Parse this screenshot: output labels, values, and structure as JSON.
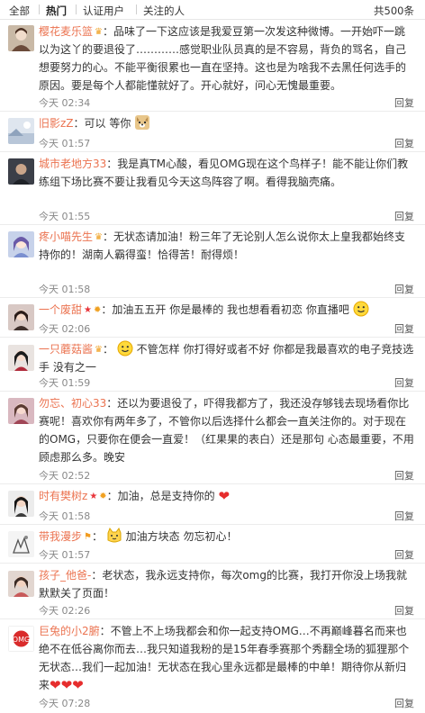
{
  "tabs": [
    "全部",
    "热门",
    "认证用户",
    "关注的人"
  ],
  "active_tab": "热门",
  "total_count": "共500条",
  "reply_label": "回复",
  "comments": [
    {
      "user": "樱花麦乐篮",
      "badge": "crown-badge-icon",
      "text": "：品味了一下这应该是我爱豆第一次发这种微博。一开始吓一跳以为这丫的要退役了…………感觉职业队员真的是不容易，背负的骂名，自己想要努力的心。不能平衡很累也一直在坚持。这也是为啥我不去黑任何选手的原因。要是每个人都能懂就好了。开心就好，问心无愧最重要。",
      "time": "今天 02:34"
    },
    {
      "user": "旧影zZ",
      "text": "：可以 等你",
      "time": "今天 01:57"
    },
    {
      "user": "城市老地方33",
      "text": "：我是真TM心酸，看见OMG现在这个鸟样子！能不能让你们教练组下场比赛不要让我看见今天这鸟阵容了啊。看得我脑壳痛。",
      "time": "今天 01:55"
    },
    {
      "user": "疼小喵先生",
      "badge": "crown-badge-icon",
      "text": "：无状态请加油！粉三年了无论别人怎么说你太上皇我都始终支持你的！湖南人霸得蛮！恰得苦！耐得烦！",
      "time": "今天 01:58"
    },
    {
      "user": "一个废甜",
      "badge": "star-badge-icon",
      "text": "：加油五五开 你是最棒的 我也想看看初恋 你直播吧",
      "time": "今天 02:06"
    },
    {
      "user": "一只蘑菇酱",
      "badge": "crown-badge-icon",
      "text": "不管怎样 你打得好或者不好 你都是我最喜欢的电子竞技选手 没有之一",
      "time": "今天 01:59"
    },
    {
      "user": "勿忘、初心33",
      "text": "：还以为要退役了，吓得我都方了，我还没存够钱去现场看你比赛呢！喜欢你有两年多了，不管你以后选择什么都会一直关注你的。对于现在的OMG，只要你在便会一直爱！（红果果的表白）还是那句 心态最重要，不用顾虑那么多。晚安",
      "time": "今天 02:52"
    },
    {
      "user": "时有樊树z",
      "badge": "star-badge-icon",
      "text": "：加油，总是支持你的",
      "time": "今天 01:58"
    },
    {
      "user": "带我漫步",
      "badge": "flag-badge-icon",
      "text": "加油方块态 勿忘初心！",
      "time": "今天 01:57"
    },
    {
      "user": "孩子_他爸-",
      "text": "：老状态，我永远支持你，每次omg的比赛，我打开你没上场我就默默关了页面！",
      "time": "今天 02:26"
    },
    {
      "user": "巨兔的小2腑",
      "text": "：不管上不上场我都会和你一起支持OMG…不再巅峰暮名而来也绝不在低谷离你而去…我只知道我粉的是15年春季赛那个秀翻全场的狐狸那个无状态…我们一起加油！无状态在我心里永远都是最棒的中单！期待你从新归来",
      "time": "今天 07:28"
    }
  ]
}
